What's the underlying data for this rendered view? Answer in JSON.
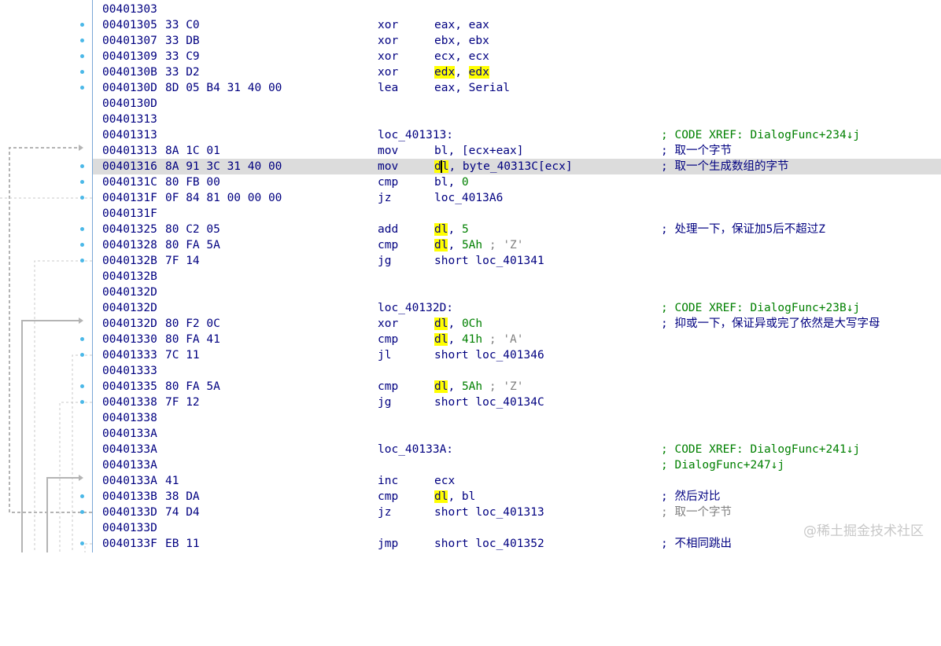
{
  "rows": [
    {
      "addr": "00401303",
      "bytes": "",
      "mnem": "",
      "ops": "",
      "label": "",
      "cmt": ""
    },
    {
      "addr": "00401305",
      "bytes": "33 C0",
      "mnem": "xor",
      "ops": "eax, eax",
      "label": "",
      "cmt": ""
    },
    {
      "addr": "00401307",
      "bytes": "33 DB",
      "mnem": "xor",
      "ops": "ebx, ebx",
      "label": "",
      "cmt": ""
    },
    {
      "addr": "00401309",
      "bytes": "33 C9",
      "mnem": "xor",
      "ops": "ecx, ecx",
      "label": "",
      "cmt": ""
    },
    {
      "addr": "0040130B",
      "bytes": "33 D2",
      "mnem": "xor",
      "ops": "edx, edx",
      "label": "",
      "cmt": ""
    },
    {
      "addr": "0040130D",
      "bytes": "8D 05 B4 31 40 00",
      "mnem": "lea",
      "ops": "eax, Serial",
      "label": "",
      "cmt": ""
    },
    {
      "addr": "0040130D",
      "bytes": "",
      "mnem": "",
      "ops": "",
      "label": "",
      "cmt": ""
    },
    {
      "addr": "00401313",
      "bytes": "",
      "mnem": "",
      "ops": "",
      "label": "",
      "cmt": ""
    },
    {
      "addr": "00401313",
      "bytes": "",
      "mnem": "",
      "ops": "",
      "label": "loc_401313:",
      "cmt": "; CODE XREF: DialogFunc+234↓j"
    },
    {
      "addr": "00401313",
      "bytes": "8A 1C 01",
      "mnem": "mov",
      "ops": "bl, [ecx+eax]",
      "label": "",
      "cmt": "; 取一个字节"
    },
    {
      "addr": "00401316",
      "bytes": "8A 91 3C 31 40 00",
      "mnem": "mov",
      "ops": "dl, byte_40313C[ecx]",
      "label": "",
      "cmt": "; 取一个生成数组的字节"
    },
    {
      "addr": "0040131C",
      "bytes": "80 FB 00",
      "mnem": "cmp",
      "ops": "bl, 0",
      "label": "",
      "cmt": ""
    },
    {
      "addr": "0040131F",
      "bytes": "0F 84 81 00 00 00",
      "mnem": "jz",
      "ops": "loc_4013A6",
      "label": "",
      "cmt": ""
    },
    {
      "addr": "0040131F",
      "bytes": "",
      "mnem": "",
      "ops": "",
      "label": "",
      "cmt": ""
    },
    {
      "addr": "00401325",
      "bytes": "80 C2 05",
      "mnem": "add",
      "ops": "dl, 5",
      "label": "",
      "cmt": "; 处理一下，保证加5后不超过Z"
    },
    {
      "addr": "00401328",
      "bytes": "80 FA 5A",
      "mnem": "cmp",
      "ops": "dl, 5Ah ; 'Z'",
      "label": "",
      "cmt": ""
    },
    {
      "addr": "0040132B",
      "bytes": "7F 14",
      "mnem": "jg",
      "ops": "short loc_401341",
      "label": "",
      "cmt": ""
    },
    {
      "addr": "0040132B",
      "bytes": "",
      "mnem": "",
      "ops": "",
      "label": "",
      "cmt": ""
    },
    {
      "addr": "0040132D",
      "bytes": "",
      "mnem": "",
      "ops": "",
      "label": "",
      "cmt": ""
    },
    {
      "addr": "0040132D",
      "bytes": "",
      "mnem": "",
      "ops": "",
      "label": "loc_40132D:",
      "cmt": "; CODE XREF: DialogFunc+23B↓j"
    },
    {
      "addr": "0040132D",
      "bytes": "80 F2 0C",
      "mnem": "xor",
      "ops": "dl, 0Ch",
      "label": "",
      "cmt": "; 抑或一下，保证异或完了依然是大写字母"
    },
    {
      "addr": "00401330",
      "bytes": "80 FA 41",
      "mnem": "cmp",
      "ops": "dl, 41h ; 'A'",
      "label": "",
      "cmt": ""
    },
    {
      "addr": "00401333",
      "bytes": "7C 11",
      "mnem": "jl",
      "ops": "short loc_401346",
      "label": "",
      "cmt": ""
    },
    {
      "addr": "00401333",
      "bytes": "",
      "mnem": "",
      "ops": "",
      "label": "",
      "cmt": ""
    },
    {
      "addr": "00401335",
      "bytes": "80 FA 5A",
      "mnem": "cmp",
      "ops": "dl, 5Ah ; 'Z'",
      "label": "",
      "cmt": ""
    },
    {
      "addr": "00401338",
      "bytes": "7F 12",
      "mnem": "jg",
      "ops": "short loc_40134C",
      "label": "",
      "cmt": ""
    },
    {
      "addr": "00401338",
      "bytes": "",
      "mnem": "",
      "ops": "",
      "label": "",
      "cmt": ""
    },
    {
      "addr": "0040133A",
      "bytes": "",
      "mnem": "",
      "ops": "",
      "label": "",
      "cmt": ""
    },
    {
      "addr": "0040133A",
      "bytes": "",
      "mnem": "",
      "ops": "",
      "label": "loc_40133A:",
      "cmt": "; CODE XREF: DialogFunc+241↓j"
    },
    {
      "addr": "0040133A",
      "bytes": "",
      "mnem": "",
      "ops": "",
      "label": "",
      "cmt": "; DialogFunc+247↓j"
    },
    {
      "addr": "0040133A",
      "bytes": "41",
      "mnem": "inc",
      "ops": "ecx",
      "label": "",
      "cmt": ""
    },
    {
      "addr": "0040133B",
      "bytes": "38 DA",
      "mnem": "cmp",
      "ops": "dl, bl",
      "label": "",
      "cmt": "; 然后对比"
    },
    {
      "addr": "0040133D",
      "bytes": "74 D4",
      "mnem": "jz",
      "ops": "short loc_401313",
      "label": "",
      "cmt": "; 取一个字节"
    },
    {
      "addr": "0040133D",
      "bytes": "",
      "mnem": "",
      "ops": "",
      "label": "",
      "cmt": ""
    },
    {
      "addr": "0040133F",
      "bytes": "EB 11",
      "mnem": "jmp",
      "ops": "short loc_401352",
      "label": "",
      "cmt": "; 不相同跳出"
    }
  ],
  "watermark": "@稀土掘金技术社区",
  "colors": {
    "address": "#000080",
    "xref_comment": "#008000",
    "highlight": "#ffff00",
    "current_line": "#dcdcdc",
    "flow_dot": "#4ab8e8"
  }
}
